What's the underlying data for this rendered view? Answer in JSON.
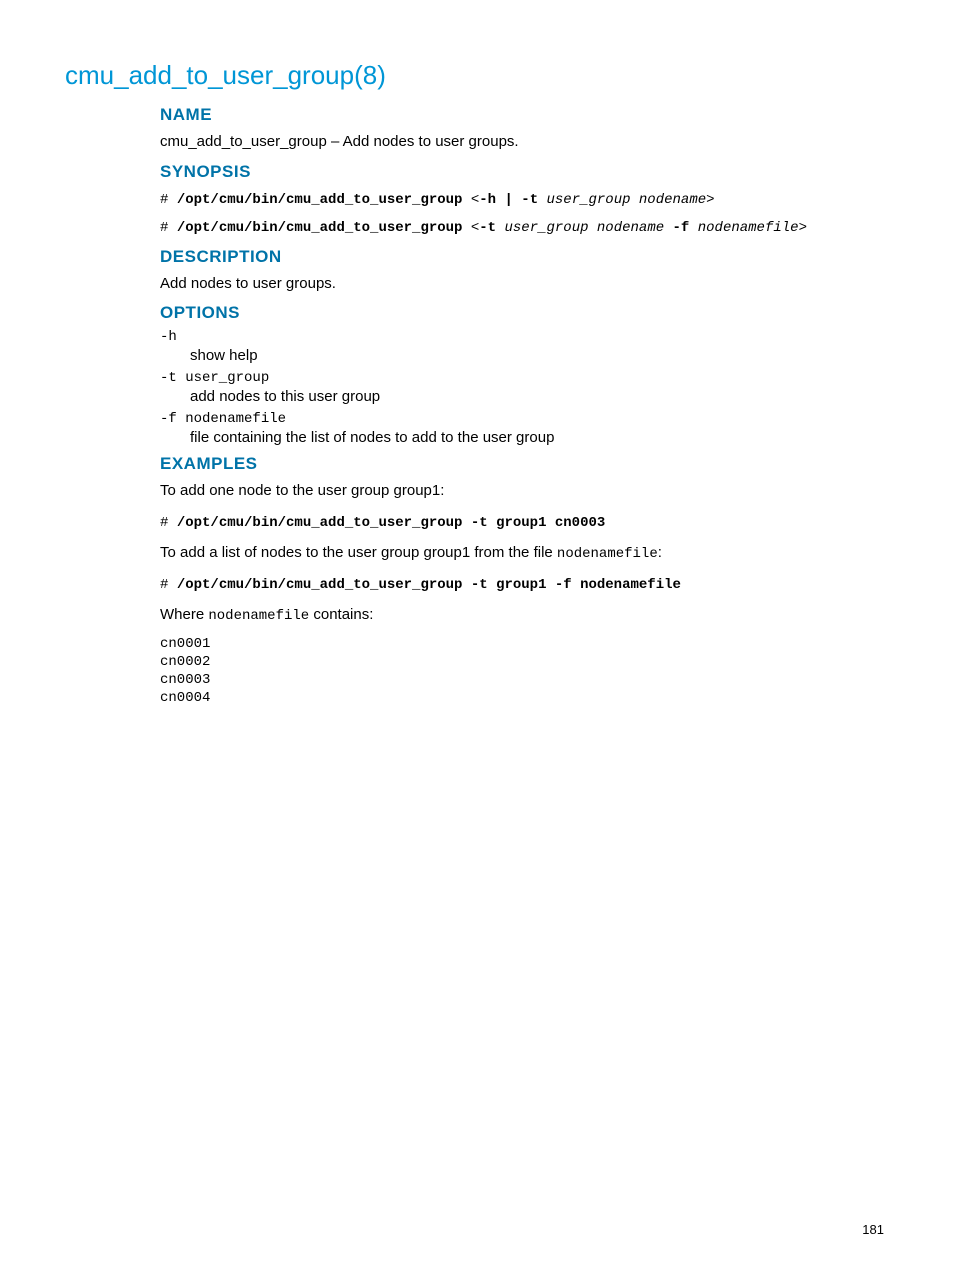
{
  "page_title": "cmu_add_to_user_group(8)",
  "sections": {
    "name": {
      "heading": "NAME",
      "text": "cmu_add_to_user_group – Add nodes to user groups."
    },
    "synopsis": {
      "heading": "SYNOPSIS",
      "line1_hash": "# ",
      "line1_path": "/opt/cmu/bin/cmu_add_to_user_group",
      "line1_open": " <",
      "line1_flags": "-h | -t",
      "line1_args": " user_group nodename",
      "line1_close": ">",
      "line2_hash": "# ",
      "line2_path": "/opt/cmu/bin/cmu_add_to_user_group",
      "line2_open": " <",
      "line2_flags": "-t",
      "line2_args": " user_group nodename",
      "line2_flag2": " -f",
      "line2_args2": " nodenamefile",
      "line2_close": ">"
    },
    "description": {
      "heading": "DESCRIPTION",
      "text": "Add nodes to user groups."
    },
    "options": {
      "heading": "OPTIONS",
      "opt1_flag": "-h",
      "opt1_desc": "show help",
      "opt2_flag": "-t user_group",
      "opt2_desc": "add nodes to this user group",
      "opt3_flag": "-f nodenamefile",
      "opt3_desc": "file containing the list of nodes to add to the user group"
    },
    "examples": {
      "heading": "EXAMPLES",
      "intro1": "To add one node to the user group group1:",
      "cmd1_hash": "# ",
      "cmd1": "/opt/cmu/bin/cmu_add_to_user_group -t group1 cn0003",
      "intro2_a": "To add a list of nodes to the user group group1 from the file ",
      "intro2_file": "nodenamefile",
      "intro2_b": ":",
      "cmd2_hash": "# ",
      "cmd2": "/opt/cmu/bin/cmu_add_to_user_group -t group1 -f nodenamefile",
      "where_a": "Where ",
      "where_file": "nodenamefile",
      "where_b": " contains:",
      "filecontent": "cn0001\ncn0002\ncn0003\ncn0004"
    }
  },
  "page_number": "181"
}
